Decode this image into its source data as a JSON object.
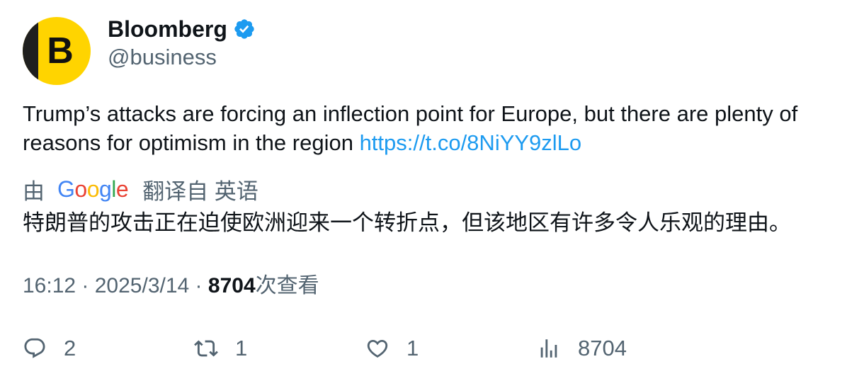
{
  "author": {
    "display_name": "Bloomberg",
    "handle": "@business",
    "avatar_letter": "B",
    "verified": true
  },
  "tweet": {
    "text": "Trump’s attacks are forcing an inflection point for Europe, but there are plenty of reasons for optimism in the region ",
    "link": "https://t.co/8NiYY9zlLo"
  },
  "translation": {
    "by_label": "由",
    "provider_letters": [
      "G",
      "o",
      "o",
      "g",
      "l",
      "e"
    ],
    "from_label": "翻译自 英语",
    "translated_text": "特朗普的攻击正在迫使欧洲迎来一个转折点，但该地区有许多令人乐观的理由。"
  },
  "meta": {
    "time": "16:12",
    "separator": " · ",
    "date": "2025/3/14",
    "views_count": "8704",
    "views_label": "次查看"
  },
  "actions": {
    "replies": "2",
    "retweets": "1",
    "likes": "1",
    "views": "8704"
  },
  "colors": {
    "link": "#1d9bf0",
    "secondary_text": "#536471",
    "primary_text": "#0f1419",
    "verified_badge": "#1d9bf0",
    "avatar_bg": "#ffd400"
  },
  "icons": [
    "verified-badge-icon",
    "reply-icon",
    "retweet-icon",
    "like-icon",
    "views-icon"
  ]
}
